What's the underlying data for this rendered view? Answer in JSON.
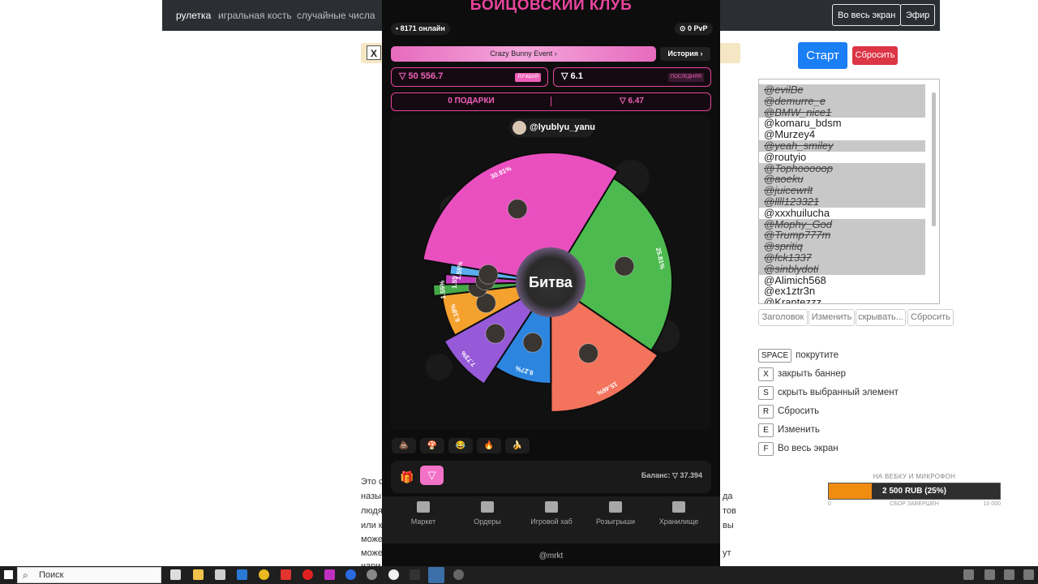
{
  "topnav": {
    "links": [
      "рулетка",
      "игральная кость",
      "случайные числа"
    ],
    "fullscreen_label": "Во весь экран",
    "live_label": "Эфир"
  },
  "banner": {
    "close_label": "X"
  },
  "controls": {
    "start_label": "Старт",
    "reset_label": "Сбросить"
  },
  "names": [
    {
      "text": "@evilBe",
      "off": true
    },
    {
      "text": "@demurre_e",
      "off": true
    },
    {
      "text": "@BMW_nice1",
      "off": true
    },
    {
      "text": "@komaru_bdsm",
      "off": false
    },
    {
      "text": "@Murzey4",
      "off": false
    },
    {
      "text": "@yeah_smiley",
      "off": true
    },
    {
      "text": "@routyio",
      "off": false
    },
    {
      "text": "@Tophooooop",
      "off": true
    },
    {
      "text": "@aoeku",
      "off": true
    },
    {
      "text": "@juicewrlt",
      "off": true
    },
    {
      "text": "@llll123321",
      "off": true
    },
    {
      "text": "@xxxhuilucha",
      "off": false
    },
    {
      "text": "@Mophy_God",
      "off": true
    },
    {
      "text": "@Trump777m",
      "off": true
    },
    {
      "text": "@spritiq",
      "off": true
    },
    {
      "text": "@fck1337",
      "off": true
    },
    {
      "text": "@sinblydoti",
      "off": true
    },
    {
      "text": "@Alimich568",
      "off": false
    },
    {
      "text": "@ex1ztr3n",
      "off": false
    },
    {
      "text": "@Krantezzz",
      "off": false
    }
  ],
  "list_buttons": [
    "Заголовок",
    "Изменить",
    "скрывать...",
    "Сбросить"
  ],
  "shortcuts": [
    {
      "key": "SPACE",
      "label": "покрутите"
    },
    {
      "key": "X",
      "label": "закрыть баннер"
    },
    {
      "key": "S",
      "label": "скрыть выбранный элемент"
    },
    {
      "key": "R",
      "label": "Сбросить"
    },
    {
      "key": "E",
      "label": "Изменить"
    },
    {
      "key": "F",
      "label": "Во весь экран"
    }
  ],
  "donation": {
    "title": "НА ВЕБКУ И МИКРОФОН",
    "amount_text": "2 500 RUB (25%)",
    "progress_percent": 25,
    "min": "0",
    "status": "СБОР ЗАВЕРШЕН",
    "max": "10 000"
  },
  "article_lines": [
    "Это с",
    "назы",
    "людя",
    "или к",
    "може",
    "може",
    "нари"
  ],
  "article_right": [
    "да",
    "тов",
    "вы",
    "ут"
  ],
  "phone": {
    "title": "БОЙЦОВСКИЙ КЛУБ",
    "online": "• 8171 онлайн",
    "pvp": "⊙ 0 PvP",
    "event_label": "Crazy Bunny Event  ›",
    "history_label": "История  ›",
    "best_value": "▽ 50 556.7",
    "best_tag": "ЛУЧШАЯ",
    "last_value": "▽ 6.1",
    "last_tag": "ПОСЛЕДНЯЯ",
    "gifts_label": "0 ПОДАРКИ",
    "gifts_value": "▽ 6.47",
    "current_user": "@lyublyu_yanu",
    "center_label": "Битва",
    "emojis": [
      "💩",
      "🍄",
      "😂",
      "🔥",
      "🍌"
    ],
    "balance_label": "Баланс: ▽ 37.394",
    "nav": [
      "Маркет",
      "Ордеры",
      "Игровой хаб",
      "Розыгрыши",
      "Хранилище"
    ],
    "footer_handle": "@mrkt"
  },
  "wheel": {
    "segments": [
      {
        "percent": 30.91,
        "label": "30.91%",
        "color": "#ea4fc0",
        "r": 160
      },
      {
        "percent": 25.81,
        "label": "25.81%",
        "color": "#4cba4f",
        "r": 150
      },
      {
        "percent": 15.46,
        "label": "15.46%",
        "color": "#f3735c",
        "r": 160
      },
      {
        "percent": 9.27,
        "label": "9.27%",
        "color": "#2c86df",
        "r": 125
      },
      {
        "percent": 7.73,
        "label": "7.73%",
        "color": "#9659d8",
        "r": 150
      },
      {
        "percent": 6.18,
        "label": "6.18%",
        "color": "#f5a12e",
        "r": 135
      },
      {
        "percent": 1.55,
        "label": "1.55%",
        "color": "#45a848",
        "r": 145
      },
      {
        "percent": 1.55,
        "label": "1.55%",
        "color": "#c03cbc",
        "r": 130
      },
      {
        "percent": 1.55,
        "label": "1.55%",
        "color": "#5aaef0",
        "r": 125
      }
    ]
  },
  "taskbar": {
    "search_placeholder": "Поиск"
  }
}
